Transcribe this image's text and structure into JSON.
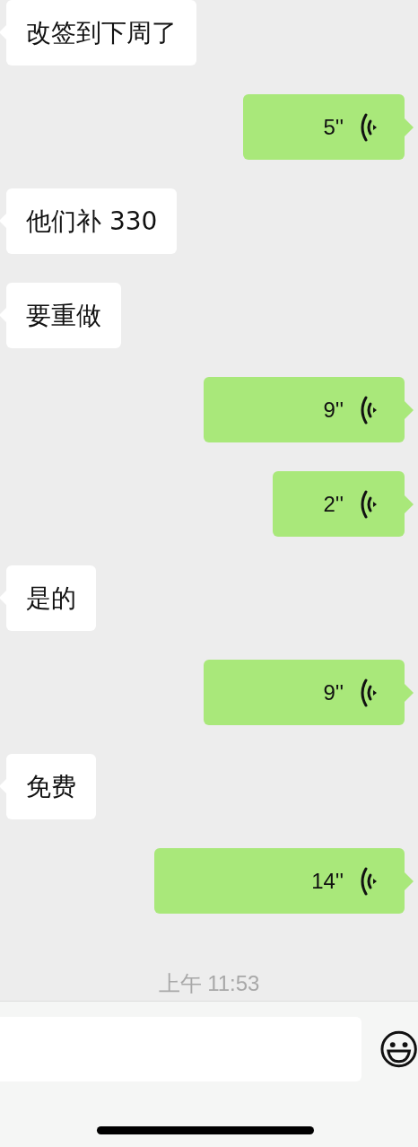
{
  "messages": [
    {
      "kind": "text",
      "text": "改签到下周了"
    },
    {
      "kind": "voice",
      "duration": "5''"
    },
    {
      "kind": "text",
      "text": "他们补 330"
    },
    {
      "kind": "text",
      "text": "要重做"
    },
    {
      "kind": "voice",
      "duration": "9''"
    },
    {
      "kind": "voice",
      "duration": "2''"
    },
    {
      "kind": "text",
      "text": "是的"
    },
    {
      "kind": "voice",
      "duration": "9''"
    },
    {
      "kind": "text",
      "text": "免费"
    },
    {
      "kind": "voice",
      "duration": "14''"
    }
  ],
  "timestamp": "上午 11:53"
}
